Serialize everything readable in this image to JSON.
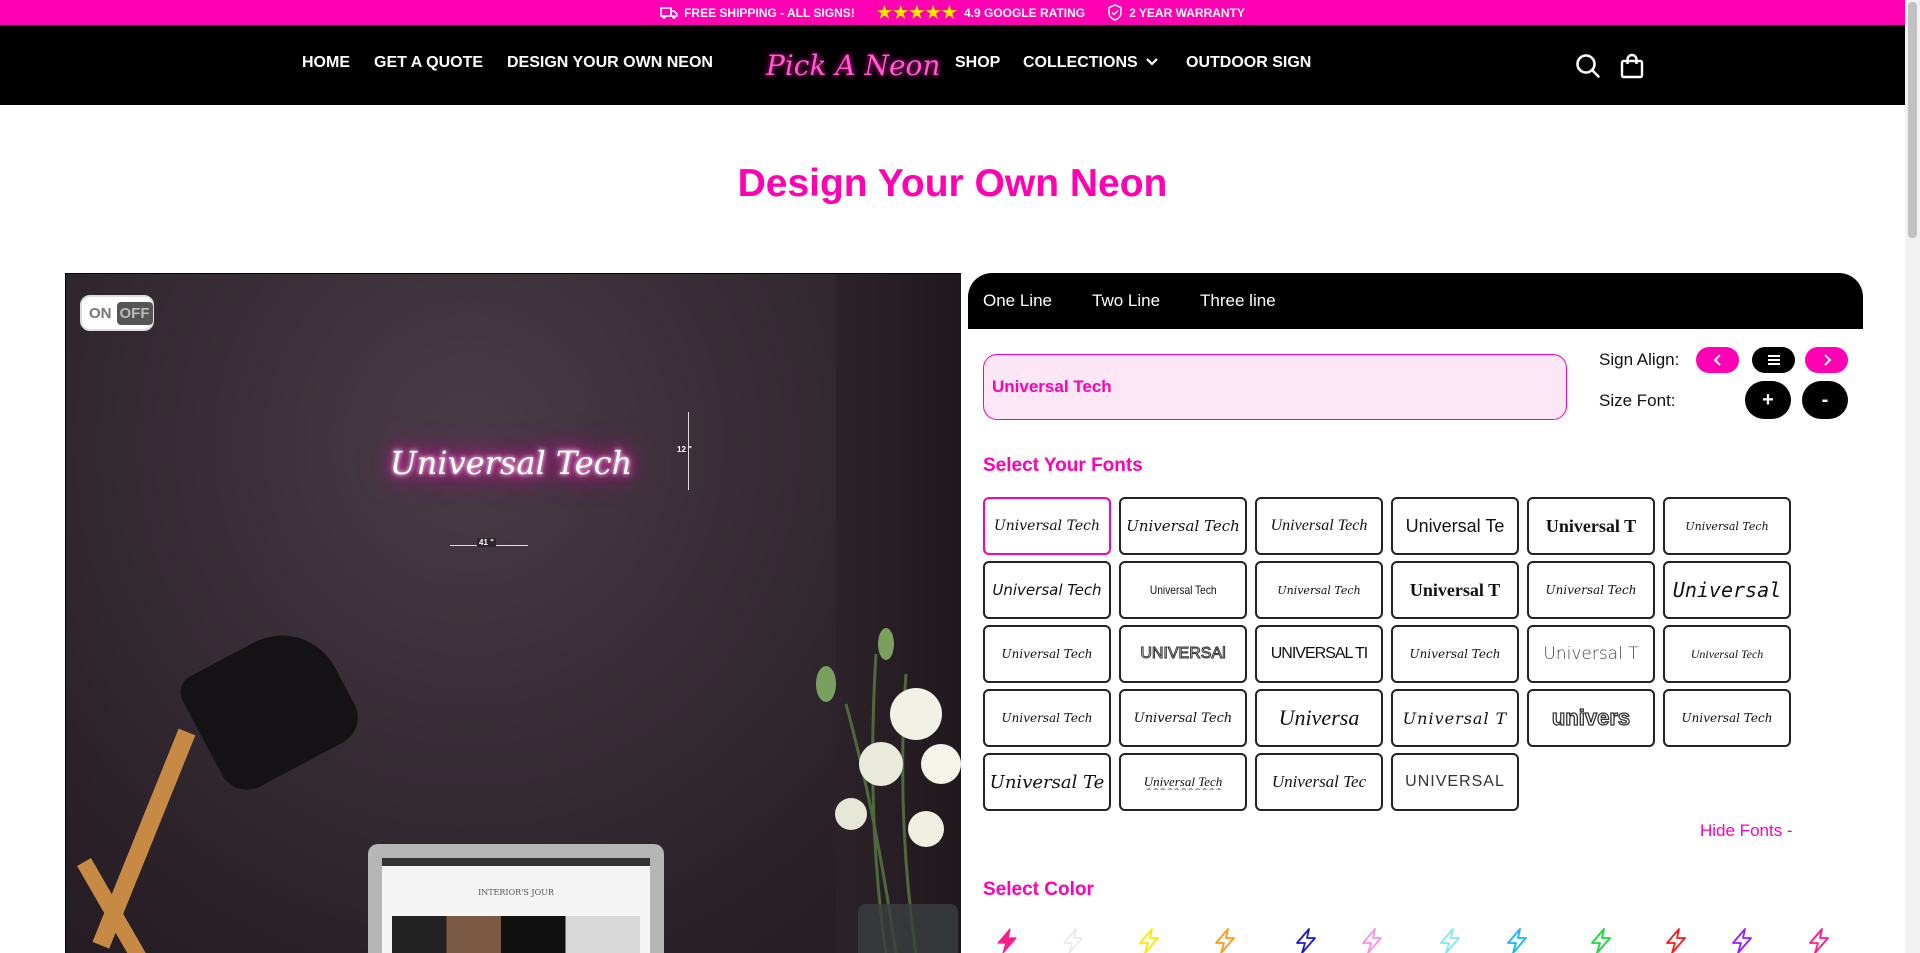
{
  "promo": {
    "shipping": "FREE SHIPPING - ALL SIGNS!",
    "stars": "★★★★★",
    "rating": "4.9 GOOGLE RATING",
    "warranty": "2 YEAR WARRANTY"
  },
  "nav": {
    "home": "HOME",
    "quote": "GET A QUOTE",
    "design": "DESIGN YOUR OWN NEON",
    "logo": "Pick A Neon",
    "shop": "SHOP",
    "collections": "COLLECTIONS",
    "outdoor": "OUTDOOR SIGN"
  },
  "page_title": "Design Your Own Neon",
  "preview": {
    "toggle_on": "ON",
    "toggle_off": "OFF",
    "neon_text": "Universal Tech",
    "height_label": "12 \"",
    "width_label": "41 \"",
    "laptop_text": "INTERIOR'S JOUR"
  },
  "tabs": [
    "One Line",
    "Two Line",
    "Three line"
  ],
  "editor": {
    "text_value": "Universal Tech",
    "sign_align_label": "Sign Align:",
    "size_font_label": "Size Font:",
    "plus": "+",
    "minus": "-"
  },
  "fonts_heading": "Select Your Fonts",
  "font_samples": [
    "Universal Tech",
    "Universal Tech",
    "Universal Tech",
    "Universal Te",
    "Universal T",
    "Universal Tech",
    "Universal Tech",
    "Universal Tech",
    "Universal Tech",
    "Universal T",
    "Universal Tech",
    "Universal",
    "Universal Tech",
    "UNIVERSAl",
    "UNIVERSAL TI",
    "Universal Tech",
    "Universal T",
    "Universal Tech",
    "Universal Tech",
    "Universal Tech",
    "Universa",
    "Universal T",
    "univers",
    "Universal Tech",
    "Universal Te",
    "Universal Tech",
    "Universal Tec",
    "UNIVERSAL"
  ],
  "hide_fonts": "Hide Fonts -",
  "color_heading": "Select Color",
  "colors": [
    "#ff1a8c",
    "#e8e8e8",
    "#ffe600",
    "#ff9a1a",
    "#1a1acc",
    "#ff8fe6",
    "#7fe8f0",
    "#14b4ff",
    "#19d93a",
    "#ff1a1a",
    "#9a1aff",
    "#ff1a8c"
  ]
}
